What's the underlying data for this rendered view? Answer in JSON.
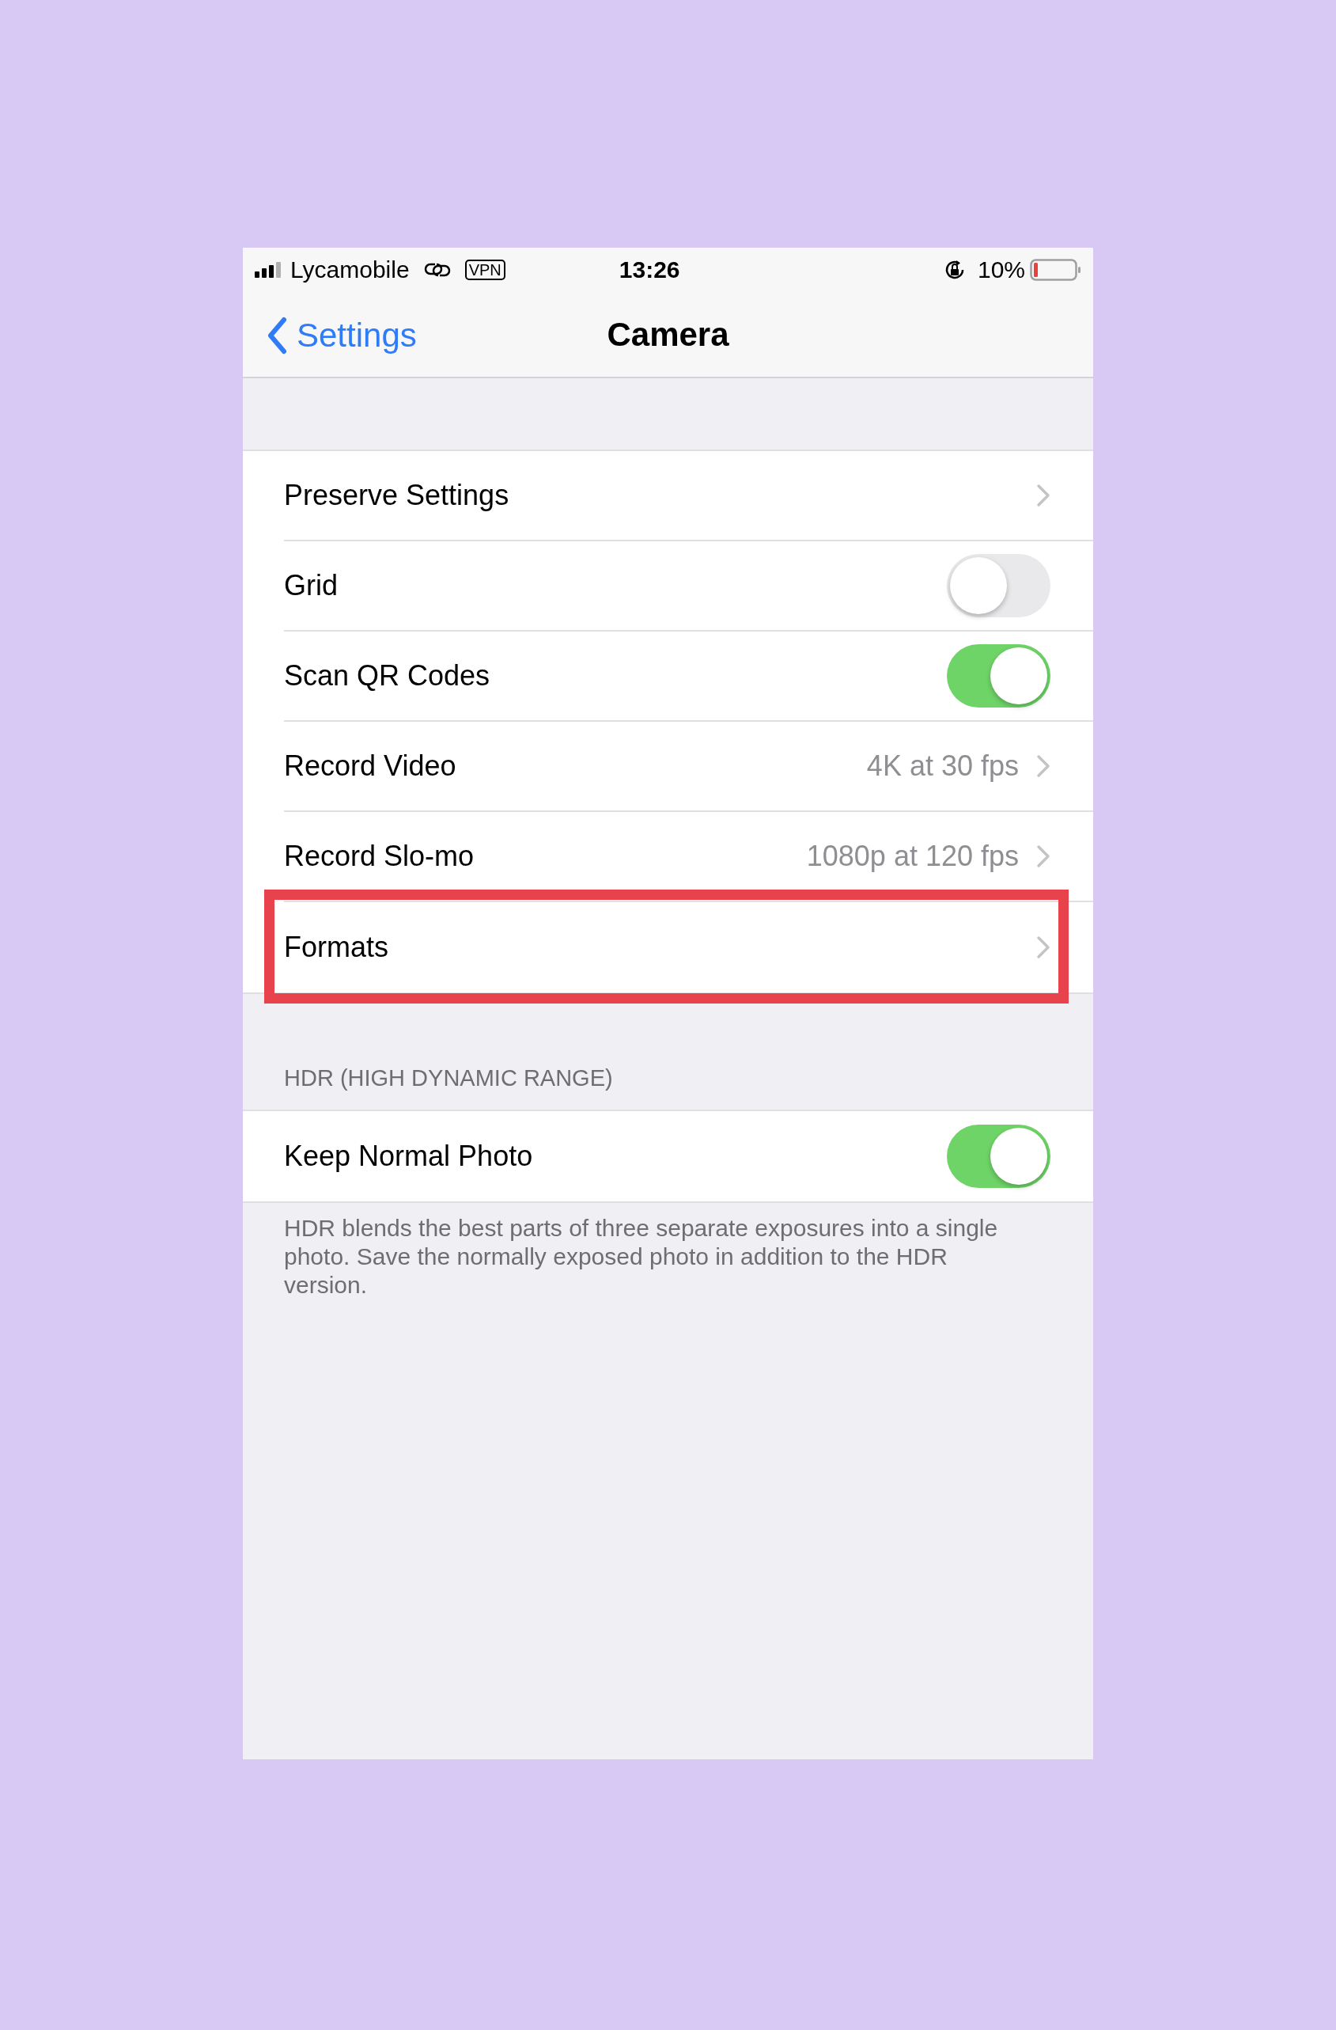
{
  "status_bar": {
    "carrier": "Lycamobile",
    "vpn": "VPN",
    "time": "13:26",
    "battery": "10%"
  },
  "nav": {
    "back": "Settings",
    "title": "Camera"
  },
  "rows": [
    {
      "kind": "link",
      "label": "Preserve Settings",
      "highlighted": false
    },
    {
      "kind": "toggle",
      "label": "Grid",
      "on": false
    },
    {
      "kind": "toggle",
      "label": "Scan QR Codes",
      "on": true
    },
    {
      "kind": "link",
      "label": "Record Video",
      "value": "4K at 30 fps",
      "highlighted": false
    },
    {
      "kind": "link",
      "label": "Record Slo-mo",
      "value": "1080p at 120 fps",
      "highlighted": false
    },
    {
      "kind": "link",
      "label": "Formats",
      "highlighted": true
    }
  ],
  "hdr_section": {
    "header": "HDR (HIGH DYNAMIC RANGE)",
    "rows": [
      {
        "kind": "toggle",
        "label": "Keep Normal Photo",
        "on": true
      }
    ],
    "footer": "HDR blends the best parts of three separate exposures into a single photo. Save the normally exposed photo in addition to the HDR version."
  }
}
